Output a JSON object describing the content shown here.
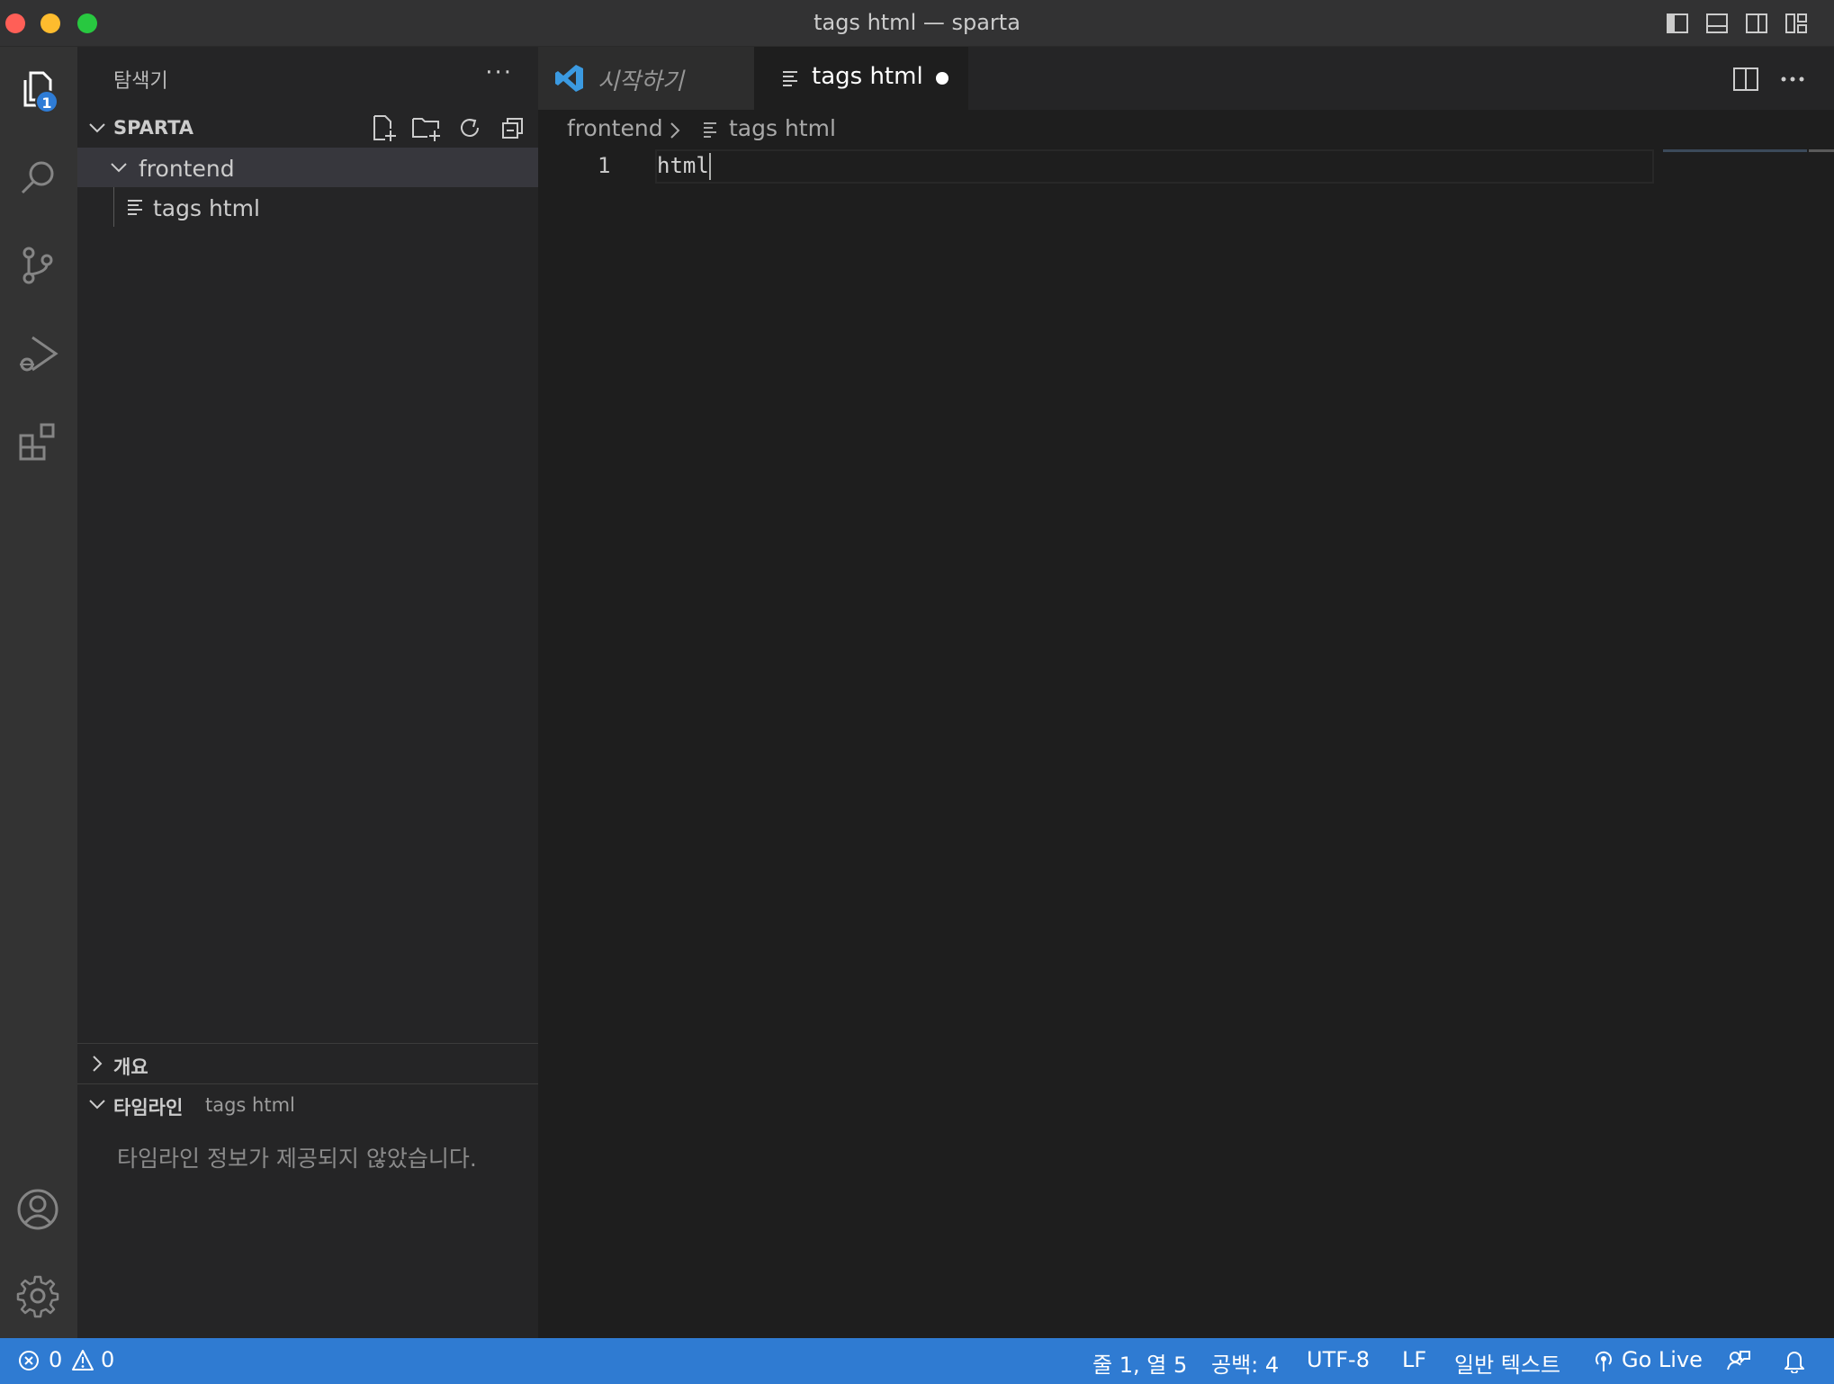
{
  "window": {
    "title": "tags html — sparta"
  },
  "activity_bar": {
    "items": [
      {
        "name": "explorer-icon",
        "badge": "1"
      },
      {
        "name": "search-icon"
      },
      {
        "name": "source-control-icon"
      },
      {
        "name": "run-debug-icon"
      },
      {
        "name": "extensions-icon"
      }
    ],
    "bottom": [
      {
        "name": "account-icon"
      },
      {
        "name": "gear-icon"
      }
    ]
  },
  "sidebar": {
    "title": "탐색기",
    "more": "···",
    "workspace": "SPARTA",
    "tree": [
      {
        "label": "frontend",
        "type": "folder",
        "expanded": true
      },
      {
        "label": "tags html",
        "type": "file"
      }
    ],
    "outline": {
      "label": "개요"
    },
    "timeline": {
      "label": "타임라인",
      "file": "tags html",
      "message": "타임라인 정보가 제공되지 않았습니다."
    }
  },
  "tabs": [
    {
      "label": "시작하기",
      "active": false
    },
    {
      "label": "tags html",
      "active": true,
      "dirty": true
    }
  ],
  "breadcrumb": {
    "folder": "frontend",
    "file": "tags html"
  },
  "editor": {
    "lines": [
      {
        "number": "1",
        "text": "html"
      }
    ]
  },
  "status": {
    "errors": "0",
    "warnings": "0",
    "position": "줄 1, 열 5",
    "spaces": "공백: 4",
    "encoding": "UTF-8",
    "eol": "LF",
    "language": "일반 텍스트",
    "golive": "Go Live"
  },
  "colors": {
    "statusbar": "#2f7bd2",
    "badge": "#2e7cd6",
    "vscode_logo": "#3b9ae1"
  }
}
